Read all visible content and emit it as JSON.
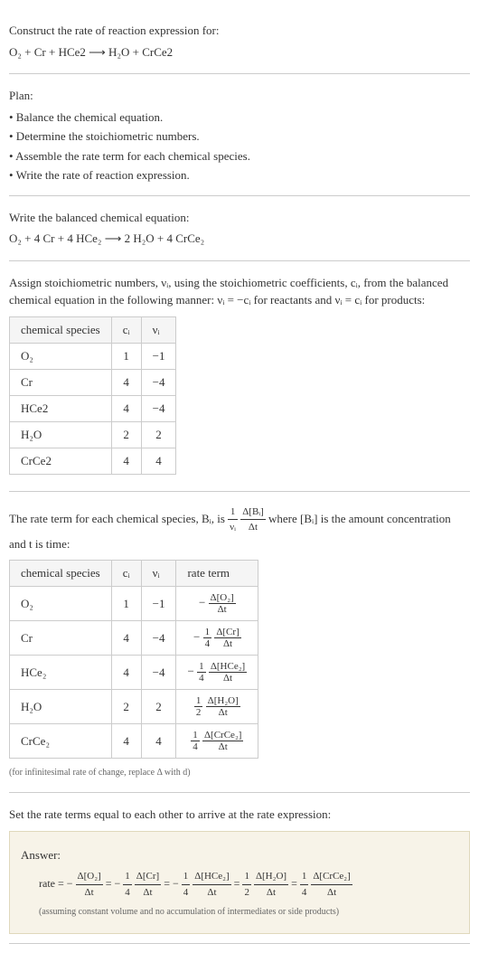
{
  "intro": {
    "title": "Construct the rate of reaction expression for:",
    "eq": "O₂ + Cr + HCe2 ⟶ H₂O + CrCe2"
  },
  "plan": {
    "title": "Plan:",
    "items": [
      "• Balance the chemical equation.",
      "• Determine the stoichiometric numbers.",
      "• Assemble the rate term for each chemical species.",
      "• Write the rate of reaction expression."
    ]
  },
  "balanced": {
    "title": "Write the balanced chemical equation:",
    "eq": "O₂ + 4 Cr + 4 HCe₂ ⟶ 2 H₂O + 4 CrCe₂"
  },
  "assign": {
    "text": "Assign stoichiometric numbers, νᵢ, using the stoichiometric coefficients, cᵢ, from the balanced chemical equation in the following manner: νᵢ = −cᵢ for reactants and νᵢ = cᵢ for products:",
    "headers": [
      "chemical species",
      "cᵢ",
      "νᵢ"
    ],
    "rows": [
      {
        "species": "O₂",
        "c": "1",
        "v": "−1"
      },
      {
        "species": "Cr",
        "c": "4",
        "v": "−4"
      },
      {
        "species": "HCe2",
        "c": "4",
        "v": "−4"
      },
      {
        "species": "H₂O",
        "c": "2",
        "v": "2"
      },
      {
        "species": "CrCe2",
        "c": "4",
        "v": "4"
      }
    ]
  },
  "rateterm": {
    "text_before": "The rate term for each chemical species, Bᵢ, is ",
    "frac1_num": "1",
    "frac1_den": "νᵢ",
    "frac2_num": "Δ[Bᵢ]",
    "frac2_den": "Δt",
    "text_after": " where [Bᵢ] is the amount concentration and t is time:",
    "headers": [
      "chemical species",
      "cᵢ",
      "νᵢ",
      "rate term"
    ],
    "rows": [
      {
        "species": "O₂",
        "c": "1",
        "v": "−1",
        "sign": "−",
        "coef_num": "",
        "coef_den": "",
        "d_num": "Δ[O₂]",
        "d_den": "Δt"
      },
      {
        "species": "Cr",
        "c": "4",
        "v": "−4",
        "sign": "−",
        "coef_num": "1",
        "coef_den": "4",
        "d_num": "Δ[Cr]",
        "d_den": "Δt"
      },
      {
        "species": "HCe₂",
        "c": "4",
        "v": "−4",
        "sign": "−",
        "coef_num": "1",
        "coef_den": "4",
        "d_num": "Δ[HCe₂]",
        "d_den": "Δt"
      },
      {
        "species": "H₂O",
        "c": "2",
        "v": "2",
        "sign": "",
        "coef_num": "1",
        "coef_den": "2",
        "d_num": "Δ[H₂O]",
        "d_den": "Δt"
      },
      {
        "species": "CrCe₂",
        "c": "4",
        "v": "4",
        "sign": "",
        "coef_num": "1",
        "coef_den": "4",
        "d_num": "Δ[CrCe₂]",
        "d_den": "Δt"
      }
    ],
    "footnote": "(for infinitesimal rate of change, replace Δ with d)"
  },
  "final": {
    "title": "Set the rate terms equal to each other to arrive at the rate expression:",
    "answer_label": "Answer:",
    "rate_prefix": "rate = ",
    "terms": [
      {
        "sign": "−",
        "coef_num": "",
        "coef_den": "",
        "d_num": "Δ[O₂]",
        "d_den": "Δt"
      },
      {
        "sign": "−",
        "coef_num": "1",
        "coef_den": "4",
        "d_num": "Δ[Cr]",
        "d_den": "Δt"
      },
      {
        "sign": "−",
        "coef_num": "1",
        "coef_den": "4",
        "d_num": "Δ[HCe₂]",
        "d_den": "Δt"
      },
      {
        "sign": "",
        "coef_num": "1",
        "coef_den": "2",
        "d_num": "Δ[H₂O]",
        "d_den": "Δt"
      },
      {
        "sign": "",
        "coef_num": "1",
        "coef_den": "4",
        "d_num": "Δ[CrCe₂]",
        "d_den": "Δt"
      }
    ],
    "note": "(assuming constant volume and no accumulation of intermediates or side products)"
  }
}
